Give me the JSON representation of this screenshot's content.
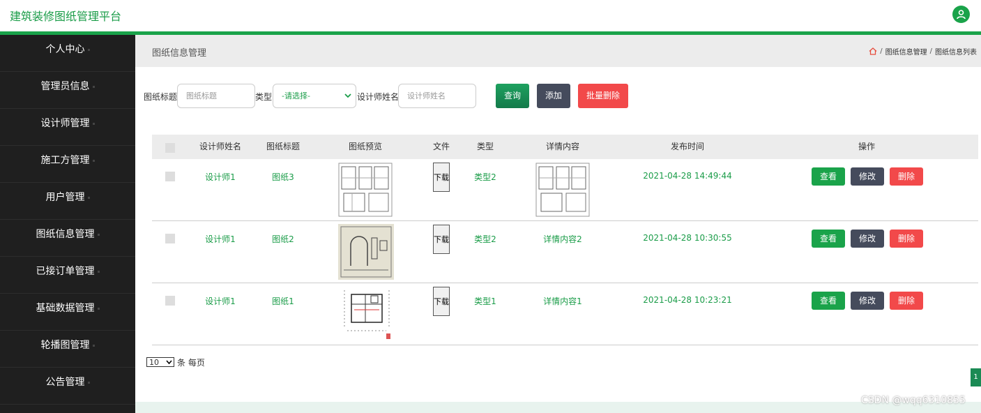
{
  "app": {
    "title": "建筑装修图纸管理平台"
  },
  "sidebar": {
    "items": [
      {
        "label": "个人中心"
      },
      {
        "label": "管理员信息"
      },
      {
        "label": "设计师管理"
      },
      {
        "label": "施工方管理"
      },
      {
        "label": "用户管理"
      },
      {
        "label": "图纸信息管理"
      },
      {
        "label": "已接订单管理"
      },
      {
        "label": "基础数据管理"
      },
      {
        "label": "轮播图管理"
      },
      {
        "label": "公告管理"
      }
    ]
  },
  "page": {
    "title": "图纸信息管理",
    "breadcrumb": [
      "图纸信息管理",
      "图纸信息列表"
    ],
    "breadcrumb_sep": "/"
  },
  "search": {
    "title_label": "图纸标题",
    "title_placeholder": "图纸标题",
    "type_label": "类型",
    "type_selected": "-请选择-",
    "designer_label": "设计师姓名",
    "designer_placeholder": "设计师姓名",
    "query_label": "查询",
    "add_label": "添加",
    "batch_delete_label": "批量删除"
  },
  "table": {
    "headers": [
      "设计师姓名",
      "图纸标题",
      "图纸预览",
      "文件",
      "类型",
      "详情内容",
      "发布时间",
      "操作"
    ],
    "rows": [
      {
        "designer": "设计师1",
        "title": "图纸3",
        "file": "下载",
        "type": "类型2",
        "detail": "",
        "time": "2021-04-28 14:49:44"
      },
      {
        "designer": "设计师1",
        "title": "图纸2",
        "file": "下载",
        "type": "类型2",
        "detail": "详情内容2",
        "time": "2021-04-28 10:30:55"
      },
      {
        "designer": "设计师1",
        "title": "图纸1",
        "file": "下载",
        "type": "类型1",
        "detail": "详情内容1",
        "time": "2021-04-28 10:23:21"
      }
    ],
    "actions": {
      "view": "查看",
      "edit": "修改",
      "delete": "删除"
    }
  },
  "pagination": {
    "page_size": "10",
    "per_page_label": "条 每页",
    "current_page": "1"
  },
  "watermark": "CSDN @wqq6310855",
  "colors": {
    "brand_green": "#1aa34a",
    "dark_button": "#454b5c",
    "red_button": "#f2494a",
    "query_green": "#1b8a5a"
  }
}
